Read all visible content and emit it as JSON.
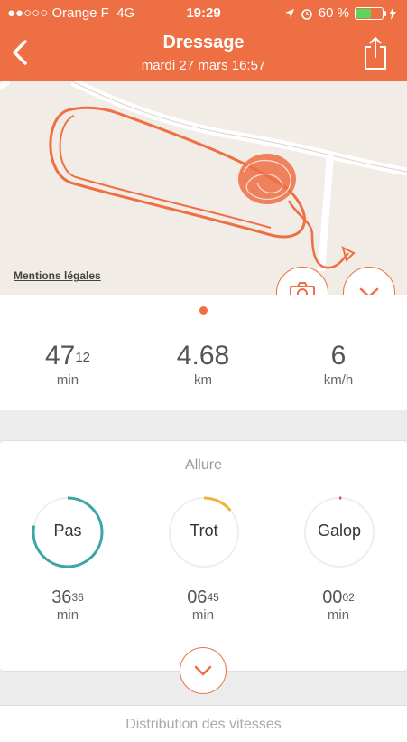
{
  "status_bar": {
    "carrier": "●●○○○ Orange F",
    "network": "4G",
    "time": "19:29",
    "battery": "60 %",
    "battery_level": 0.6
  },
  "header": {
    "title": "Dressage",
    "subtitle": "mardi 27 mars 16:57"
  },
  "map": {
    "mentions_label": "Mentions légales"
  },
  "stats": [
    {
      "value": "47",
      "sup": "12",
      "unit": "min"
    },
    {
      "value": "4.68",
      "sup": "",
      "unit": "km"
    },
    {
      "value": "6",
      "sup": "",
      "unit": "km/h"
    }
  ],
  "allure": {
    "title": "Allure",
    "gaits": [
      {
        "label": "Pas",
        "time": "36",
        "time_sup": "36",
        "unit": "min",
        "color": "#3aa6a6",
        "fraction": 0.78
      },
      {
        "label": "Trot",
        "time": "06",
        "time_sup": "45",
        "unit": "min",
        "color": "#f2b233",
        "fraction": 0.14
      },
      {
        "label": "Galop",
        "time": "00",
        "time_sup": "02",
        "unit": "min",
        "color": "#e84c4c",
        "fraction": 0.01
      }
    ]
  },
  "next_section": "Distribution des vitesses",
  "colors": {
    "accent": "#ee6f44"
  }
}
